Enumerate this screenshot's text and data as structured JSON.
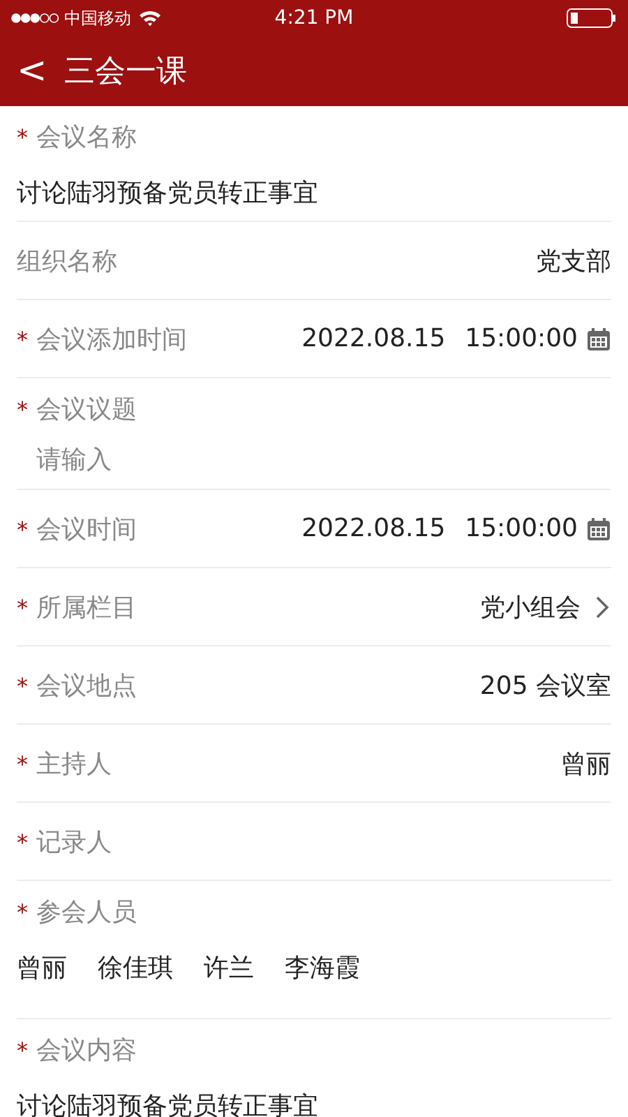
{
  "status_bar": {
    "carrier": "中国移动",
    "time": "4:21 PM"
  },
  "nav": {
    "back": "<",
    "title": "三会一课"
  },
  "required_mark": "*",
  "fields": [
    {
      "kind": "stacked",
      "label": "会议名称",
      "required": true,
      "value": "讨论陆羽预备党员转正事宜"
    },
    {
      "kind": "inline",
      "label": "组织名称",
      "required": false,
      "value": "党支部"
    },
    {
      "kind": "date",
      "label": "会议添加时间",
      "required": true,
      "date": "2022.08.15",
      "time": "15:00:00"
    },
    {
      "kind": "input",
      "label": "会议议题",
      "required": true,
      "placeholder": "请输入"
    },
    {
      "kind": "date",
      "label": "会议时间",
      "required": true,
      "date": "2022.08.15",
      "time": "15:00:00"
    },
    {
      "kind": "select",
      "label": "所属栏目",
      "required": true,
      "value": "党小组会"
    },
    {
      "kind": "inline",
      "label": "会议地点",
      "required": true,
      "value": "205 会议室"
    },
    {
      "kind": "inline",
      "label": "主持人",
      "required": true,
      "value": "曾丽"
    },
    {
      "kind": "inline",
      "label": "记录人",
      "required": true
    },
    {
      "kind": "people",
      "label": "参会人员",
      "required": true,
      "people": [
        "曾丽",
        "徐佳琪",
        "许兰",
        "李海霞"
      ]
    },
    {
      "kind": "stacked",
      "label": "会议内容",
      "required": true,
      "value": "讨论陆羽预备党员转正事宜"
    }
  ]
}
